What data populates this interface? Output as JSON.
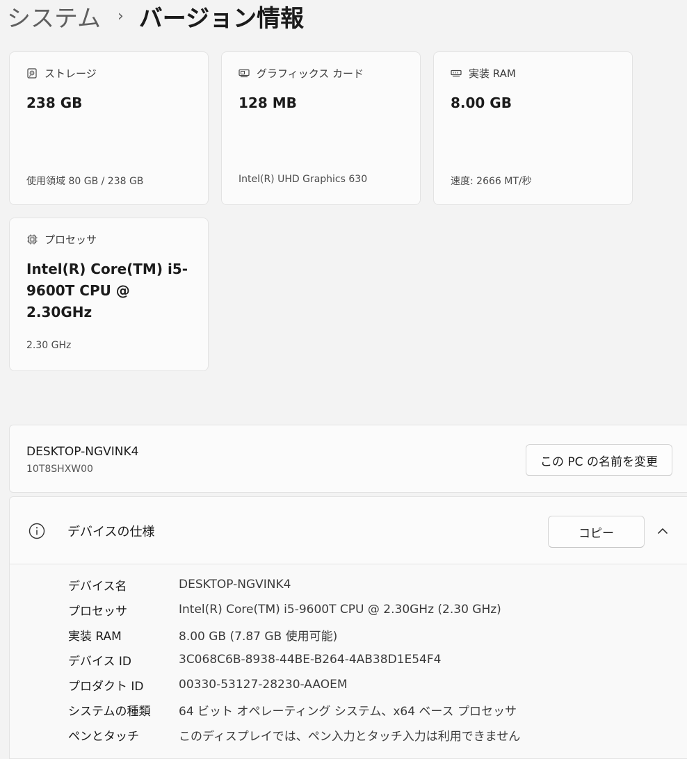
{
  "breadcrumb": {
    "root": "システム",
    "separator": "›",
    "current": "バージョン情報"
  },
  "cards": {
    "storage": {
      "title": "ストレージ",
      "value": "238 GB",
      "sub": "使用領域 80 GB / 238 GB",
      "icon": "hard-drive-icon"
    },
    "graphics": {
      "title": "グラフィックス カード",
      "value": "128 MB",
      "sub": "Intel(R) UHD Graphics 630",
      "icon": "graphics-card-icon"
    },
    "ram": {
      "title": "実装 RAM",
      "value": "8.00 GB",
      "sub": "速度: 2666 MT/秒",
      "icon": "memory-icon"
    },
    "processor": {
      "title": "プロセッサ",
      "value": "Intel(R) Core(TM) i5-9600T CPU @ 2.30GHz",
      "sub": "2.30 GHz",
      "icon": "cpu-icon"
    }
  },
  "pc": {
    "name": "DESKTOP-NGVINK4",
    "model": "10T8SHXW00",
    "rename_label": "この PC の名前を変更"
  },
  "device_specs": {
    "title": "デバイスの仕様",
    "copy_label": "コピー",
    "icon": "info-icon",
    "rows": [
      {
        "label": "デバイス名",
        "value": "DESKTOP-NGVINK4"
      },
      {
        "label": "プロセッサ",
        "value": "Intel(R) Core(TM) i5-9600T CPU @ 2.30GHz (2.30 GHz)"
      },
      {
        "label": "実装 RAM",
        "value": "8.00 GB (7.87 GB 使用可能)"
      },
      {
        "label": "デバイス ID",
        "value": "3C068C6B-8938-44BE-B264-4AB38D1E54F4"
      },
      {
        "label": "プロダクト ID",
        "value": "00330-53127-28230-AAOEM"
      },
      {
        "label": "システムの種類",
        "value": "64 ビット オペレーティング システム、x64 ベース プロセッサ"
      },
      {
        "label": "ペンとタッチ",
        "value": "このディスプレイでは、ペン入力とタッチ入力は利用できません"
      }
    ]
  }
}
